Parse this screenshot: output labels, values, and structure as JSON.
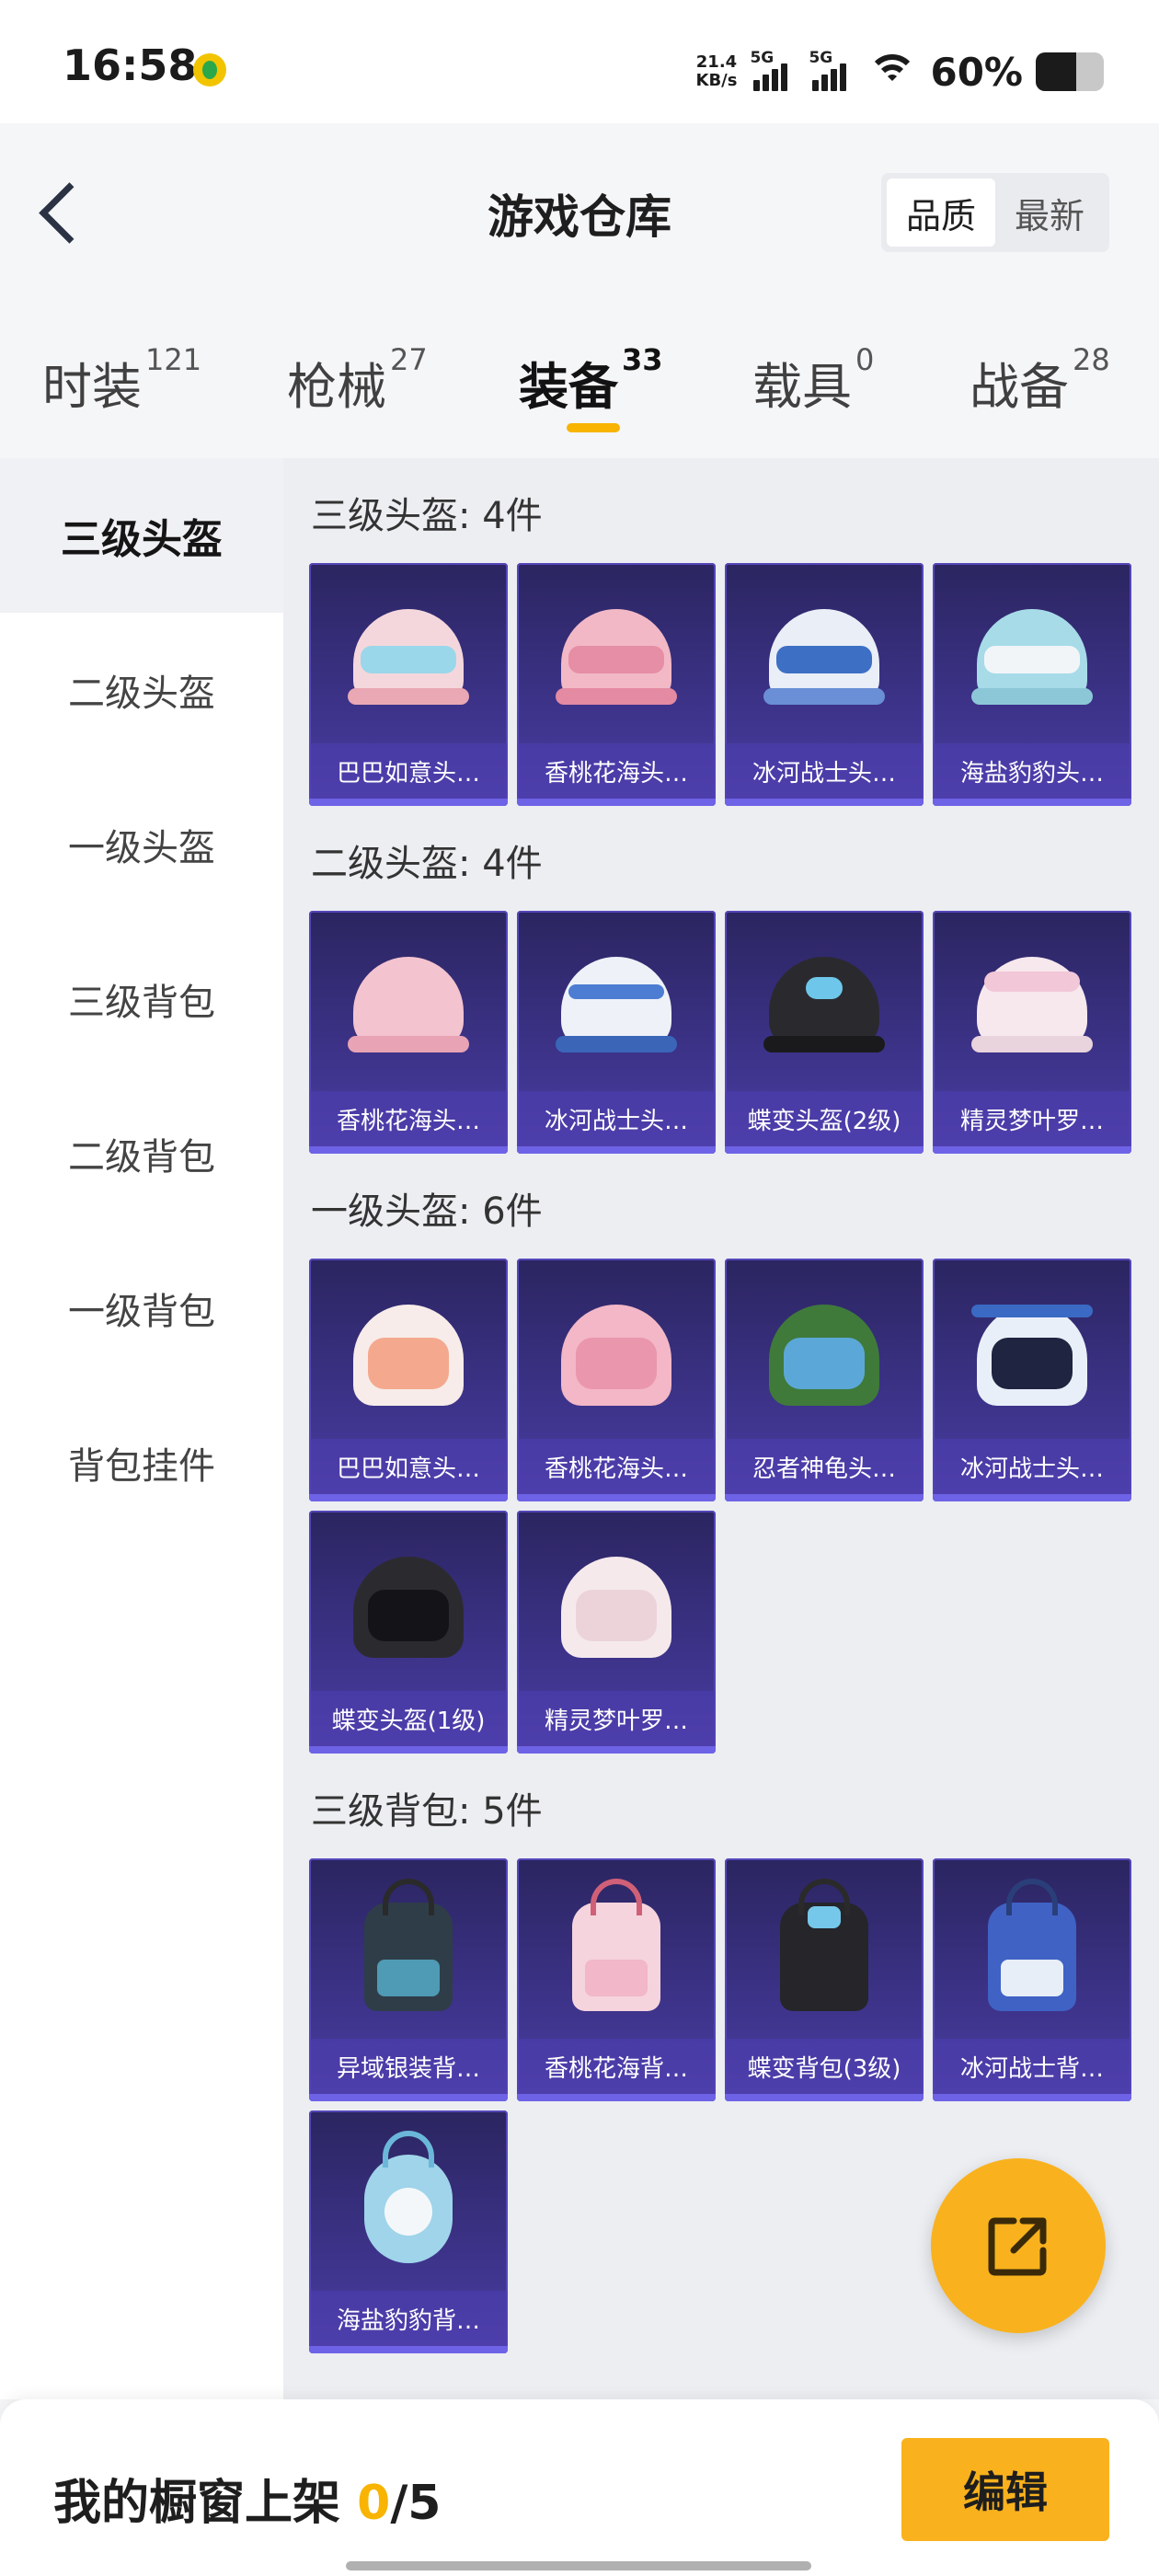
{
  "status_bar": {
    "time": "16:58",
    "net_speed_value": "21.4",
    "net_speed_unit": "KB/s",
    "sim1_label": "5G",
    "sim2_label": "5G",
    "battery_text": "60%",
    "battery_level": 0.6
  },
  "header": {
    "title": "游戏仓库",
    "sort_options": [
      "品质",
      "最新"
    ],
    "sort_selected": "品质"
  },
  "tabs": [
    {
      "label": "时装",
      "count": "121"
    },
    {
      "label": "枪械",
      "count": "27"
    },
    {
      "label": "装备",
      "count": "33"
    },
    {
      "label": "载具",
      "count": "0"
    },
    {
      "label": "战备",
      "count": "28"
    }
  ],
  "active_tab": "装备",
  "categories": [
    "三级头盔",
    "二级头盔",
    "一级头盔",
    "三级背包",
    "二级背包",
    "一级背包",
    "背包挂件"
  ],
  "active_category": "三级头盔",
  "sections": [
    {
      "title": "三级头盔: 4件",
      "items": [
        "巴巴如意头…",
        "香桃花海头…",
        "冰河战士头…",
        "海盐豹豹头…"
      ]
    },
    {
      "title": "二级头盔: 4件",
      "items": [
        "香桃花海头…",
        "冰河战士头…",
        "蝶变头盔(2级)",
        "精灵梦叶罗…"
      ]
    },
    {
      "title": "一级头盔: 6件",
      "items": [
        "巴巴如意头…",
        "香桃花海头…",
        "忍者神龟头…",
        "冰河战士头…",
        "蝶变头盔(1级)",
        "精灵梦叶罗…"
      ]
    },
    {
      "title": "三级背包: 5件",
      "items": [
        "异域银装背…",
        "香桃花海背…",
        "蝶变背包(3级)",
        "冰河战士背…",
        "海盐豹豹背…"
      ]
    }
  ],
  "bottom": {
    "shelf_label": "我的橱窗上架",
    "shelf_count": "0",
    "shelf_total": "/5",
    "edit_label": "编辑"
  },
  "colors": {
    "accent": "#f9b21d",
    "card_bg": "#3d338a"
  }
}
